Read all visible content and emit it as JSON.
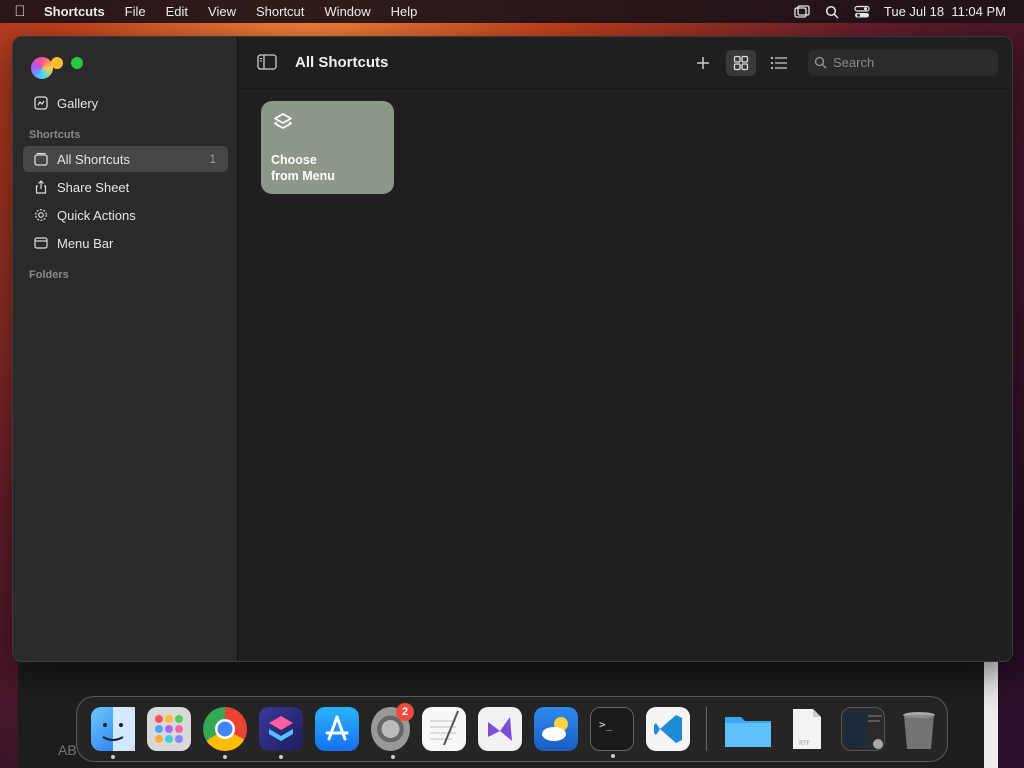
{
  "menubar": {
    "app_name": "Shortcuts",
    "items": [
      "File",
      "Edit",
      "View",
      "Shortcut",
      "Window",
      "Help"
    ],
    "clock": "Tue Jul 18  11:04 PM"
  },
  "sidebar": {
    "gallery_label": "Gallery",
    "shortcuts_section": "Shortcuts",
    "items": [
      {
        "label": "All Shortcuts",
        "count": "1"
      },
      {
        "label": "Share Sheet"
      },
      {
        "label": "Quick Actions"
      },
      {
        "label": "Menu Bar"
      }
    ],
    "folders_section": "Folders"
  },
  "toolbar": {
    "title": "All Shortcuts",
    "search_placeholder": "Search"
  },
  "shortcut_cards": [
    {
      "line1": "Choose",
      "line2": "from Menu",
      "color": "#8c978a"
    }
  ],
  "background_text": "AB",
  "dock": {
    "apps": [
      "finder",
      "launchpad",
      "chrome",
      "shortcuts",
      "app-store",
      "system-settings",
      "textedit",
      "visual-studio",
      "weather",
      "terminal",
      "vscode"
    ],
    "settings_badge": "2",
    "right_items": [
      "downloads-folder",
      "rtf-document",
      "screenshot-thumbnail",
      "trash"
    ]
  }
}
